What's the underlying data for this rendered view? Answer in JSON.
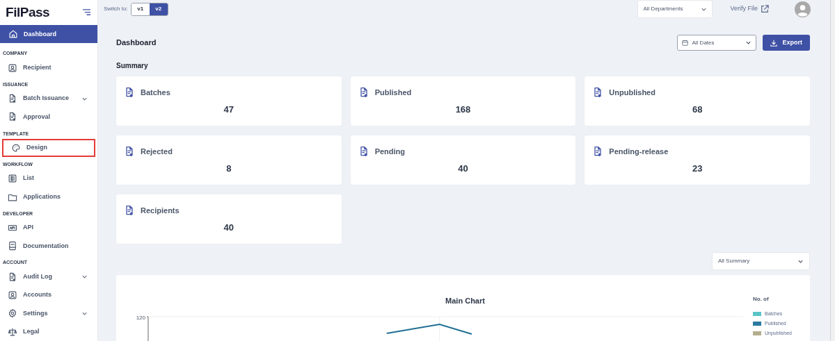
{
  "brand": {
    "logo": "FilPass"
  },
  "topbar": {
    "switch_label": "Switch to:",
    "versions": [
      {
        "label": "v1",
        "selected": false
      },
      {
        "label": "v2",
        "selected": true
      }
    ],
    "department": "All Departments",
    "verify": "Verify File"
  },
  "sidebar": {
    "sections": [
      {
        "items": [
          {
            "label": "Dashboard",
            "selected": true,
            "expandable": false,
            "highlighted": false
          }
        ]
      },
      {
        "title": "COMPANY",
        "items": [
          {
            "label": "Recipient",
            "selected": false,
            "expandable": false,
            "highlighted": false
          }
        ]
      },
      {
        "title": "ISSUANCE",
        "items": [
          {
            "label": "Batch Issuance",
            "selected": false,
            "expandable": true,
            "highlighted": false
          },
          {
            "label": "Approval",
            "selected": false,
            "expandable": false,
            "highlighted": false
          }
        ]
      },
      {
        "title": "TEMPLATE",
        "items": [
          {
            "label": "Design",
            "selected": false,
            "expandable": false,
            "highlighted": true
          }
        ]
      },
      {
        "title": "WORKFLOW",
        "items": [
          {
            "label": "List",
            "selected": false,
            "expandable": false,
            "highlighted": false
          },
          {
            "label": "Applications",
            "selected": false,
            "expandable": false,
            "highlighted": false
          }
        ]
      },
      {
        "title": "DEVELOPER",
        "items": [
          {
            "label": "API",
            "selected": false,
            "expandable": false,
            "highlighted": false
          },
          {
            "label": "Documentation",
            "selected": false,
            "expandable": false,
            "highlighted": false
          }
        ]
      },
      {
        "title": "ACCOUNT",
        "items": [
          {
            "label": "Audit Log",
            "selected": false,
            "expandable": true,
            "highlighted": false
          },
          {
            "label": "Accounts",
            "selected": false,
            "expandable": false,
            "highlighted": false
          },
          {
            "label": "Settings",
            "selected": false,
            "expandable": true,
            "highlighted": false
          },
          {
            "label": "Legal",
            "selected": false,
            "expandable": false,
            "highlighted": false
          }
        ]
      }
    ]
  },
  "page": {
    "title": "Dashboard",
    "date_filter": "All Dates",
    "export": "Export",
    "summary_title": "Summary"
  },
  "cards": [
    {
      "label": "Batches",
      "value": "47"
    },
    {
      "label": "Published",
      "value": "168"
    },
    {
      "label": "Unpublished",
      "value": "68"
    },
    {
      "label": "Rejected",
      "value": "8"
    },
    {
      "label": "Pending",
      "value": "40"
    },
    {
      "label": "Pending-release",
      "value": "23"
    },
    {
      "label": "Recipients",
      "value": "40"
    }
  ],
  "summary_filter": "All Summary",
  "chart": {
    "title": "Main Chart",
    "y_tick": "120",
    "legend_title": "No. of",
    "legend": [
      {
        "label": "Batches",
        "color": "#5bc4c7"
      },
      {
        "label": "Published",
        "color": "#2a7aa0"
      },
      {
        "label": "Unpublished",
        "color": "#b4ad8e"
      }
    ]
  }
}
